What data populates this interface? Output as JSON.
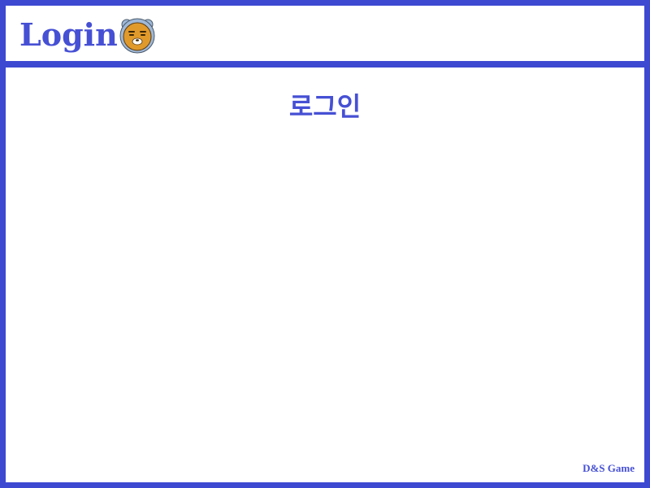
{
  "header": {
    "title": "Login",
    "mascot_icon": "bear-face-icon"
  },
  "main": {
    "heading": "로그인"
  },
  "footer": {
    "brand": "D&S Game"
  },
  "colors": {
    "accent": "#3d49d1",
    "text": "#4650d4",
    "mascot_face": "#e09a2c",
    "background": "#ffffff"
  }
}
